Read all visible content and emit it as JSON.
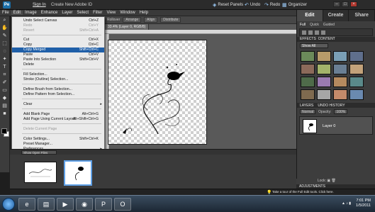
{
  "titlebar": {
    "logo": "Pe",
    "sign_in": "Sign In",
    "create_id": "Create New Adobe ID",
    "reset_panels": "Reset Panels",
    "undo": "Undo",
    "redo": "Redo",
    "organizer": "Organizer"
  },
  "menubar": [
    "File",
    "Edit",
    "Image",
    "Enhance",
    "Layer",
    "Select",
    "Filter",
    "View",
    "Window",
    "Help"
  ],
  "options_bar": {
    "rollover": "Rollover",
    "arrange": "Arrange",
    "align": "Align",
    "distribute": "Distribute"
  },
  "document": {
    "tab": "33.4% (Layer 0, RGB/8)"
  },
  "edit_menu": {
    "items": [
      {
        "label": "Undo Select Canvas",
        "shortcut": "Ctrl+Z",
        "disabled": false,
        "highlight": false
      },
      {
        "label": "Redo",
        "shortcut": "Ctrl+Y",
        "disabled": true,
        "highlight": false
      },
      {
        "label": "Revert",
        "shortcut": "Shift+Ctrl+A",
        "disabled": true,
        "highlight": false
      },
      {
        "label": "Cut",
        "shortcut": "Ctrl+X",
        "disabled": false,
        "highlight": false
      },
      {
        "label": "Copy",
        "shortcut": "Ctrl+C",
        "disabled": false,
        "highlight": false
      },
      {
        "label": "Copy Merged",
        "shortcut": "Shift+Ctrl+C",
        "disabled": false,
        "highlight": true
      },
      {
        "label": "Paste",
        "shortcut": "Ctrl+V",
        "disabled": false,
        "highlight": false
      },
      {
        "label": "Paste Into Selection",
        "shortcut": "Shift+Ctrl+V",
        "disabled": false,
        "highlight": false
      },
      {
        "label": "Delete",
        "shortcut": "",
        "disabled": false,
        "highlight": false
      },
      {
        "label": "Fill Selection...",
        "shortcut": "",
        "disabled": false,
        "highlight": false
      },
      {
        "label": "Stroke (Outline) Selection...",
        "shortcut": "",
        "disabled": false,
        "highlight": false
      },
      {
        "label": "Define Brush from Selection...",
        "shortcut": "",
        "disabled": false,
        "highlight": false
      },
      {
        "label": "Define Pattern from Selection...",
        "shortcut": "",
        "disabled": false,
        "highlight": false
      },
      {
        "label": "Clear",
        "shortcut": "",
        "disabled": false,
        "highlight": false
      },
      {
        "label": "Add Blank Page",
        "shortcut": "Alt+Ctrl+G",
        "disabled": false,
        "highlight": false
      },
      {
        "label": "Add Page Using Current Layout",
        "shortcut": "Alt+Shift+Ctrl+G",
        "disabled": false,
        "highlight": false
      },
      {
        "label": "Delete Current Page",
        "shortcut": "",
        "disabled": true,
        "highlight": false
      },
      {
        "label": "Color Settings...",
        "shortcut": "Shift+Ctrl+K",
        "disabled": false,
        "highlight": false
      },
      {
        "label": "Preset Manager...",
        "shortcut": "",
        "disabled": false,
        "highlight": false
      },
      {
        "label": "Preferences",
        "shortcut": "",
        "disabled": false,
        "highlight": false
      }
    ]
  },
  "right_panel": {
    "tabs": [
      "Edit",
      "Create",
      "Share"
    ],
    "subtabs": [
      "Full",
      "Quick",
      "Guided"
    ],
    "effects_title": "EFFECTS",
    "content_title": "CONTENT",
    "effects_filter": "Show All",
    "layers_title": "LAYERS",
    "undo_history_title": "UNDO HISTORY",
    "blend_mode": "Normal",
    "opacity_label": "Opacity:",
    "opacity_value": "100%",
    "layer_name": "Layer 0",
    "lock_label": "Lock:",
    "adjustments_title": "ADJUSTMENTS",
    "thumb_colors": [
      "#6b8a5a",
      "#b79b6a",
      "#7a9fb5",
      "#5f6f8c",
      "#8c6a5a",
      "#a3b36a",
      "#6a7f94",
      "#c2a27a",
      "#4f6b4a",
      "#9a7ab0",
      "#b58a5f",
      "#5a8a8a",
      "#7f6a4f",
      "#a6a6a6",
      "#c48a6a",
      "#6a8ab0"
    ]
  },
  "project_bin": {
    "show": "Show Open Files"
  },
  "tour": {
    "text": "Take a tour of the Full Edit tools. Click here."
  },
  "taskbar": {
    "time": "7:01 PM",
    "date": "1/5/2011"
  }
}
